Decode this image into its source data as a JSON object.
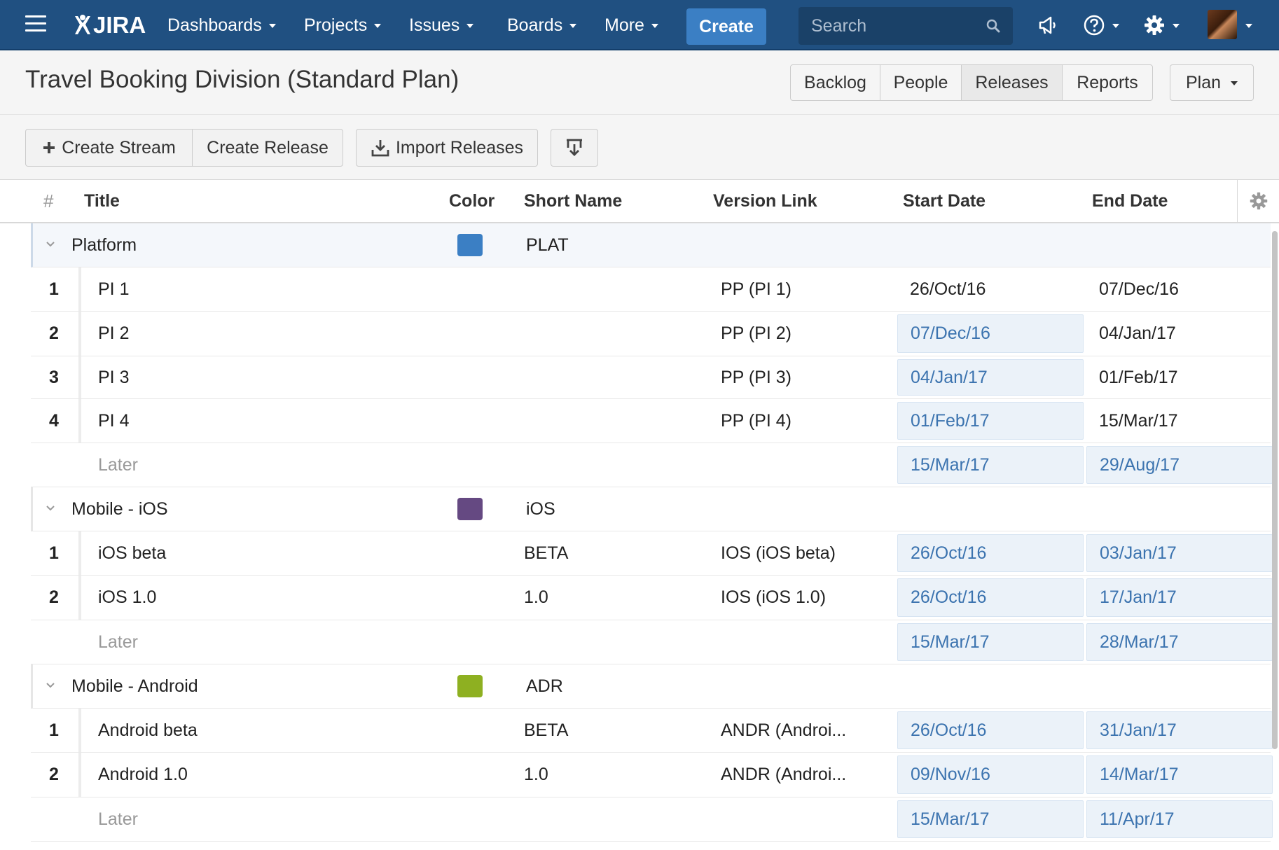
{
  "nav": {
    "logo": "JIRA",
    "items": [
      {
        "label": "Dashboards"
      },
      {
        "label": "Projects"
      },
      {
        "label": "Issues"
      },
      {
        "label": "Boards"
      },
      {
        "label": "More"
      }
    ],
    "create_label": "Create",
    "search_placeholder": "Search"
  },
  "header": {
    "title": "Travel Booking Division (Standard Plan)",
    "tabs": [
      "Backlog",
      "People",
      "Releases",
      "Reports"
    ],
    "active_tab": "Releases",
    "plan_label": "Plan"
  },
  "toolbar": {
    "create_stream": "Create Stream",
    "create_release": "Create Release",
    "import_releases": "Import Releases"
  },
  "table": {
    "columns": {
      "hash": "#",
      "title": "Title",
      "color": "Color",
      "short_name": "Short Name",
      "version_link": "Version Link",
      "start_date": "Start Date",
      "end_date": "End Date"
    },
    "streams": [
      {
        "title": "Platform",
        "color": "#3b7fc4",
        "short_name": "PLAT",
        "releases": [
          {
            "num": "1",
            "title": "PI 1",
            "short_name": "",
            "version_link": "PP (PI 1)",
            "start": "26/Oct/16",
            "end": "07/Dec/16"
          },
          {
            "num": "2",
            "title": "PI 2",
            "short_name": "",
            "version_link": "PP (PI 2)",
            "start": "07/Dec/16",
            "end": "04/Jan/17"
          },
          {
            "num": "3",
            "title": "PI 3",
            "short_name": "",
            "version_link": "PP (PI 3)",
            "start": "04/Jan/17",
            "end": "01/Feb/17"
          },
          {
            "num": "4",
            "title": "PI 4",
            "short_name": "",
            "version_link": "PP (PI 4)",
            "start": "01/Feb/17",
            "end": "15/Mar/17"
          }
        ],
        "later": {
          "label": "Later",
          "start": "15/Mar/17",
          "end": "29/Aug/17"
        }
      },
      {
        "title": "Mobile - iOS",
        "color": "#654982",
        "short_name": "iOS",
        "releases": [
          {
            "num": "1",
            "title": "iOS beta",
            "short_name": "BETA",
            "version_link": "IOS (iOS beta)",
            "start": "26/Oct/16",
            "end": "03/Jan/17"
          },
          {
            "num": "2",
            "title": "iOS 1.0",
            "short_name": "1.0",
            "version_link": "IOS (iOS 1.0)",
            "start": "26/Oct/16",
            "end": "17/Jan/17"
          }
        ],
        "later": {
          "label": "Later",
          "start": "15/Mar/17",
          "end": "28/Mar/17"
        }
      },
      {
        "title": "Mobile - Android",
        "color": "#8eb021",
        "short_name": "ADR",
        "releases": [
          {
            "num": "1",
            "title": "Android beta",
            "short_name": "BETA",
            "version_link": "ANDR (Androi...",
            "start": "26/Oct/16",
            "end": "31/Jan/17"
          },
          {
            "num": "2",
            "title": "Android 1.0",
            "short_name": "1.0",
            "version_link": "ANDR (Androi...",
            "start": "09/Nov/16",
            "end": "14/Mar/17"
          }
        ],
        "later": {
          "label": "Later",
          "start": "15/Mar/17",
          "end": "11/Apr/17"
        }
      }
    ]
  }
}
